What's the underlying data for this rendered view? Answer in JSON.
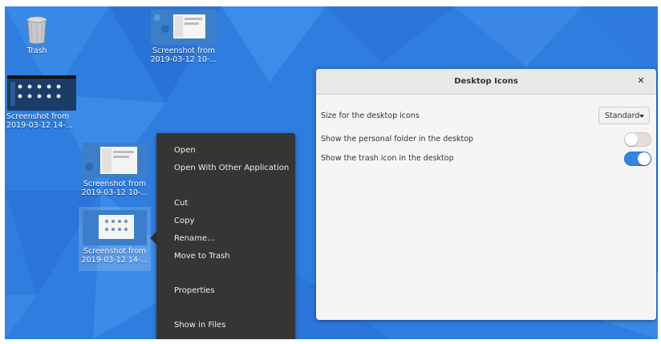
{
  "desktop": {
    "icons": [
      {
        "label": "Trash"
      },
      {
        "label": "Screenshot from 2019-03-12 10-..."
      },
      {
        "label": "Screenshot from 2019-03-12 14-..."
      },
      {
        "label": "Screenshot from 2019-03-12 10-..."
      },
      {
        "label": "Screenshot from 2019-03-12 14-..."
      }
    ]
  },
  "context_menu": {
    "items": [
      "Open",
      "Open With Other Application",
      "Cut",
      "Copy",
      "Rename…",
      "Move to Trash",
      "Properties",
      "Show in Files"
    ]
  },
  "dialog": {
    "title": "Desktop Icons",
    "close_icon": "close-icon",
    "rows": [
      {
        "label": "Size for the desktop icons",
        "control": "dropdown",
        "value": "Standard"
      },
      {
        "label": "Show the personal folder in the desktop",
        "control": "switch",
        "state": "off"
      },
      {
        "label": "Show the trash icon in the desktop",
        "control": "switch",
        "state": "on"
      }
    ]
  },
  "colors": {
    "accent": "#3584e4",
    "menu_bg": "#353535",
    "wallpaper": "#2e78de"
  }
}
